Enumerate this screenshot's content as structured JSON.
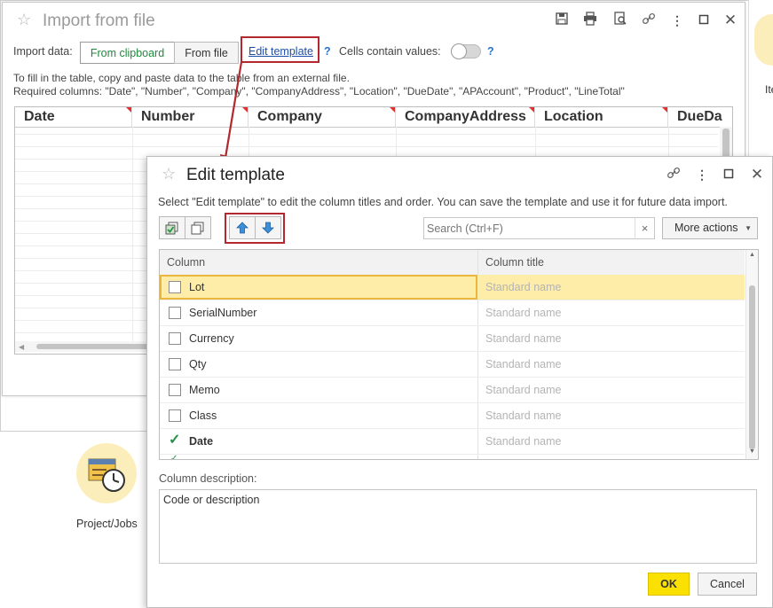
{
  "import_dialog": {
    "title": "Import from file",
    "import_label": "Import data:",
    "btn_clipboard": "From clipboard",
    "btn_file": "From file",
    "edit_template_link": "Edit template",
    "help_mark": "?",
    "cells_label": "Cells contain values:",
    "info_line1": "To fill in the table, copy and paste data to the table from an external file.",
    "info_line2": "Required columns: \"Date\", \"Number\", \"Company\", \"CompanyAddress\", \"Location\", \"DueDate\", \"APAccount\", \"Product\", \"LineTotal\"",
    "columns": [
      "Date",
      "Number",
      "Company",
      "CompanyAddress",
      "Location",
      "DueDa"
    ]
  },
  "background": {
    "project_label": "Project/Jobs",
    "right_fragment": "Ite"
  },
  "edit_dialog": {
    "title": "Edit template",
    "instruction": "Select \"Edit template\" to edit the column titles and order. You can save the template and use it for future data import.",
    "search_placeholder": "Search (Ctrl+F)",
    "search_clear": "×",
    "more_actions": "More actions",
    "col_header_column": "Column",
    "col_header_title": "Column title",
    "rows": [
      {
        "name": "Lot",
        "title": "Standard name",
        "checked": false
      },
      {
        "name": "SerialNumber",
        "title": "Standard name",
        "checked": false
      },
      {
        "name": "Currency",
        "title": "Standard name",
        "checked": false
      },
      {
        "name": "Qty",
        "title": "Standard name",
        "checked": false
      },
      {
        "name": "Memo",
        "title": "Standard name",
        "checked": false
      },
      {
        "name": "Class",
        "title": "Standard name",
        "checked": false
      },
      {
        "name": "Date",
        "title": "Standard name",
        "checked": true
      }
    ],
    "description_label": "Column description:",
    "description_value": "Code or description",
    "ok_label": "OK",
    "cancel_label": "Cancel"
  },
  "colors": {
    "accent_red": "#b3282e",
    "ok_yellow": "#fae101",
    "selected_row": "#fdeda8",
    "check_green": "#25924a",
    "link_blue": "#1f4ea8"
  }
}
